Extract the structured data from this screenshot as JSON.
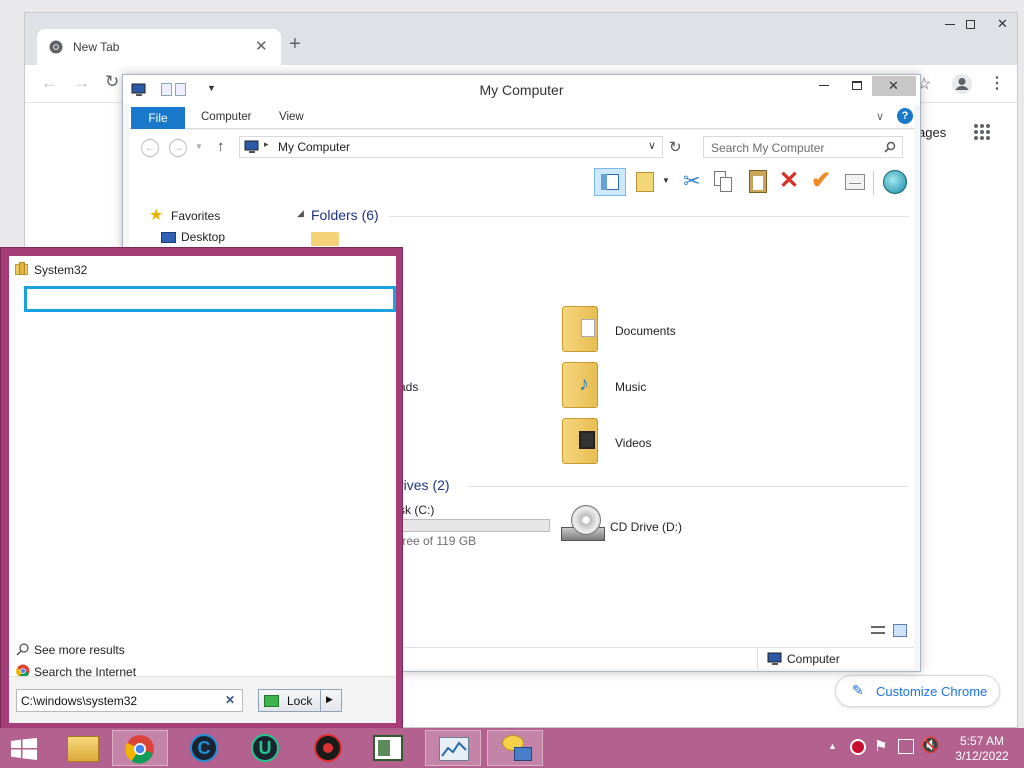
{
  "chrome": {
    "tab_title": "New Tab",
    "apps_partial": "ages",
    "customize_label": "Customize Chrome"
  },
  "explorer": {
    "title": "My Computer",
    "ribbon": {
      "file": "File",
      "computer": "Computer",
      "view": "View"
    },
    "address": "My Computer",
    "search_placeholder": "Search My Computer",
    "nav": {
      "favorites": "Favorites",
      "desktop": "Desktop"
    },
    "folders_heading": "Folders (6)",
    "folders": [
      {
        "label": "Documents",
        "icon": "documents-folder-icon"
      },
      {
        "label": "Music",
        "icon": "music-folder-icon"
      },
      {
        "label": "Videos",
        "icon": "videos-folder-icon"
      },
      {
        "label": "ads",
        "icon": "folder-icon"
      }
    ],
    "drives_heading": "rives (2)",
    "drive_c": {
      "label": "sk (C:)",
      "space": "free of 119 GB"
    },
    "drive_d": {
      "label": "CD Drive (D:)"
    },
    "status_computer": "Computer"
  },
  "start_menu": {
    "result_folder": "System32",
    "see_more": "See more results",
    "search_internet": "Search the Internet",
    "search_value": "C:\\windows\\system32",
    "lock_label": "Lock",
    "accent_color": "#a43d78"
  },
  "taskbar": {
    "time": "5:57 AM",
    "date": "3/12/2022",
    "color": "#b3628f"
  }
}
